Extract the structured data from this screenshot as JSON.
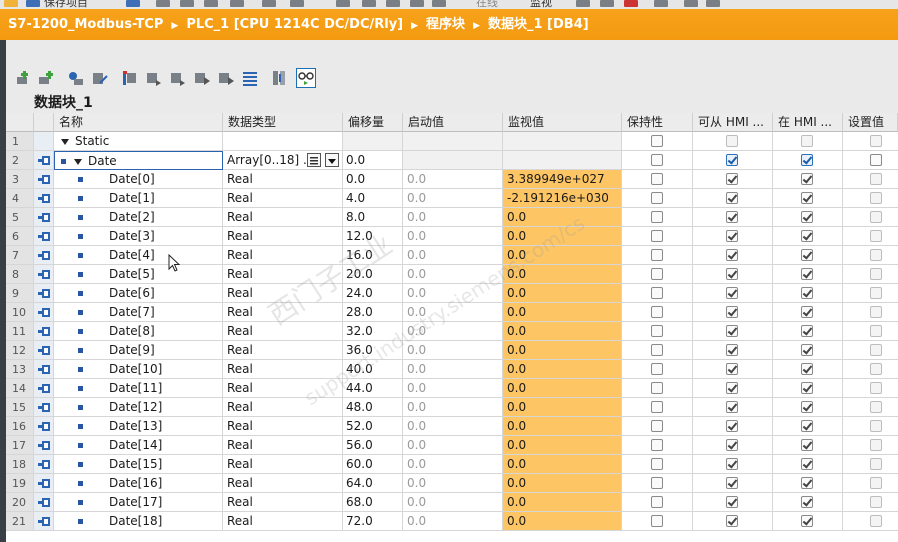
{
  "topbar": {
    "save_label": "保存项目",
    "online_label": "在线",
    "monitor_label": "监视"
  },
  "breadcrumb": {
    "project": "S7-1200_Modbus-TCP",
    "plc": "PLC_1 [CPU 1214C DC/DC/Rly]",
    "folder": "程序块",
    "block": "数据块_1 [DB4]"
  },
  "editor": {
    "title": "数据块_1"
  },
  "columns": {
    "name": "名称",
    "type": "数据类型",
    "offset": "偏移量",
    "start": "启动值",
    "monitor": "监视值",
    "retain": "保持性",
    "hmi_access": "可从 HMI ...",
    "hmi_visible": "在 HMI ...",
    "setpoint": "设置值"
  },
  "rows": [
    {
      "num": "1",
      "name": "Static",
      "type": "",
      "offset": "",
      "start": "",
      "monitor": ""
    },
    {
      "num": "2",
      "name": "Date",
      "type": "Array[0..18] ...",
      "offset": "0.0",
      "start": "",
      "monitor": ""
    },
    {
      "num": "3",
      "name": "Date[0]",
      "type": "Real",
      "offset": "0.0",
      "start": "0.0",
      "monitor": "3.389949e+027"
    },
    {
      "num": "4",
      "name": "Date[1]",
      "type": "Real",
      "offset": "4.0",
      "start": "0.0",
      "monitor": "-2.191216e+030"
    },
    {
      "num": "5",
      "name": "Date[2]",
      "type": "Real",
      "offset": "8.0",
      "start": "0.0",
      "monitor": "0.0"
    },
    {
      "num": "6",
      "name": "Date[3]",
      "type": "Real",
      "offset": "12.0",
      "start": "0.0",
      "monitor": "0.0"
    },
    {
      "num": "7",
      "name": "Date[4]",
      "type": "Real",
      "offset": "16.0",
      "start": "0.0",
      "monitor": "0.0"
    },
    {
      "num": "8",
      "name": "Date[5]",
      "type": "Real",
      "offset": "20.0",
      "start": "0.0",
      "monitor": "0.0"
    },
    {
      "num": "9",
      "name": "Date[6]",
      "type": "Real",
      "offset": "24.0",
      "start": "0.0",
      "monitor": "0.0"
    },
    {
      "num": "10",
      "name": "Date[7]",
      "type": "Real",
      "offset": "28.0",
      "start": "0.0",
      "monitor": "0.0"
    },
    {
      "num": "11",
      "name": "Date[8]",
      "type": "Real",
      "offset": "32.0",
      "start": "0.0",
      "monitor": "0.0"
    },
    {
      "num": "12",
      "name": "Date[9]",
      "type": "Real",
      "offset": "36.0",
      "start": "0.0",
      "monitor": "0.0"
    },
    {
      "num": "13",
      "name": "Date[10]",
      "type": "Real",
      "offset": "40.0",
      "start": "0.0",
      "monitor": "0.0"
    },
    {
      "num": "14",
      "name": "Date[11]",
      "type": "Real",
      "offset": "44.0",
      "start": "0.0",
      "monitor": "0.0"
    },
    {
      "num": "15",
      "name": "Date[12]",
      "type": "Real",
      "offset": "48.0",
      "start": "0.0",
      "monitor": "0.0"
    },
    {
      "num": "16",
      "name": "Date[13]",
      "type": "Real",
      "offset": "52.0",
      "start": "0.0",
      "monitor": "0.0"
    },
    {
      "num": "17",
      "name": "Date[14]",
      "type": "Real",
      "offset": "56.0",
      "start": "0.0",
      "monitor": "0.0"
    },
    {
      "num": "18",
      "name": "Date[15]",
      "type": "Real",
      "offset": "60.0",
      "start": "0.0",
      "monitor": "0.0"
    },
    {
      "num": "19",
      "name": "Date[16]",
      "type": "Real",
      "offset": "64.0",
      "start": "0.0",
      "monitor": "0.0"
    },
    {
      "num": "20",
      "name": "Date[17]",
      "type": "Real",
      "offset": "68.0",
      "start": "0.0",
      "monitor": "0.0"
    },
    {
      "num": "21",
      "name": "Date[18]",
      "type": "Real",
      "offset": "72.0",
      "start": "0.0",
      "monitor": "0.0"
    }
  ],
  "watermark": {
    "line1": "西门子工业",
    "line2": "support.industry.siemens.com/cs"
  },
  "colors": {
    "breadcrumb_bg": "#f39a10",
    "monitor_highlight": "#fdc563",
    "selection_blue": "#2a61b0"
  },
  "toolbar_icons": [
    "insert-row-icon",
    "add-row-icon",
    "expand-icon",
    "collapse-icon",
    "snapshot-icon",
    "copy-snapshot-icon",
    "load-snapshot-icon",
    "start-values-icon",
    "reset-start-values-icon",
    "list-icon",
    "settings-icon",
    "monitor-glasses-icon"
  ]
}
